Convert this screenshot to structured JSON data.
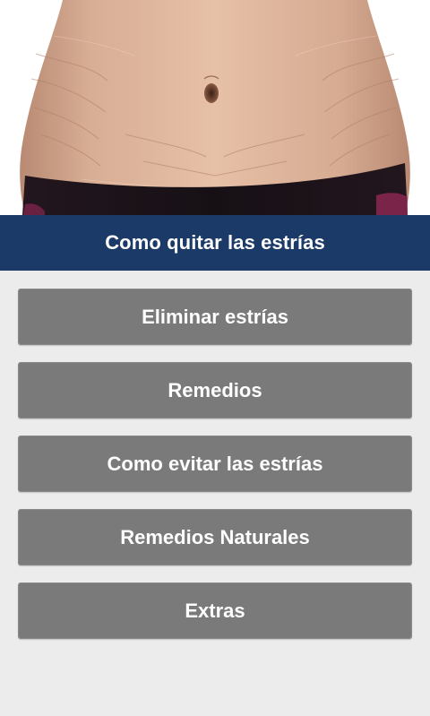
{
  "hero": {
    "image_icon": "abdomen-photo"
  },
  "header": {
    "title": "Como quitar las estrías",
    "background": "#1b3a68"
  },
  "menu": {
    "button_color": "#7a7a7a",
    "items": [
      {
        "label": "Eliminar estrías"
      },
      {
        "label": "Remedios"
      },
      {
        "label": "Como evitar las estrías"
      },
      {
        "label": "Remedios Naturales"
      },
      {
        "label": "Extras"
      }
    ]
  }
}
